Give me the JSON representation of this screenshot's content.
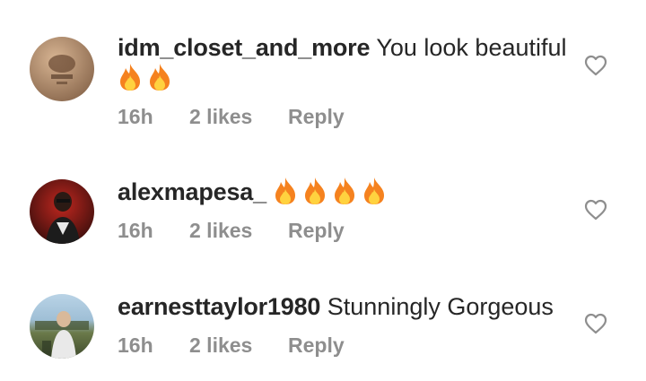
{
  "comments": [
    {
      "username": "idm_closet_and_more",
      "text": "You look beautiful",
      "emoji_count": 2,
      "time": "16h",
      "likes": "2 likes",
      "reply": "Reply",
      "avatar_colors": [
        "#c9a27e",
        "#8c6a4f"
      ]
    },
    {
      "username": "alexmapesa_",
      "text": "",
      "emoji_count": 4,
      "time": "16h",
      "likes": "2 likes",
      "reply": "Reply",
      "avatar_colors": [
        "#a31d1d",
        "#2a1010"
      ]
    },
    {
      "username": "earnesttaylor1980",
      "text": "Stunningly Gorgeous",
      "emoji_count": 0,
      "time": "16h",
      "likes": "2 likes",
      "reply": "Reply",
      "avatar_colors": [
        "#8fb0c6",
        "#5b6b3a"
      ]
    }
  ],
  "icons": {
    "like": "heart-outline-icon",
    "emoji": "fire-emoji"
  },
  "colors": {
    "text": "#262626",
    "meta": "#8e8e8e",
    "fire_outer": "#f5821f",
    "fire_inner": "#ffd23f"
  }
}
